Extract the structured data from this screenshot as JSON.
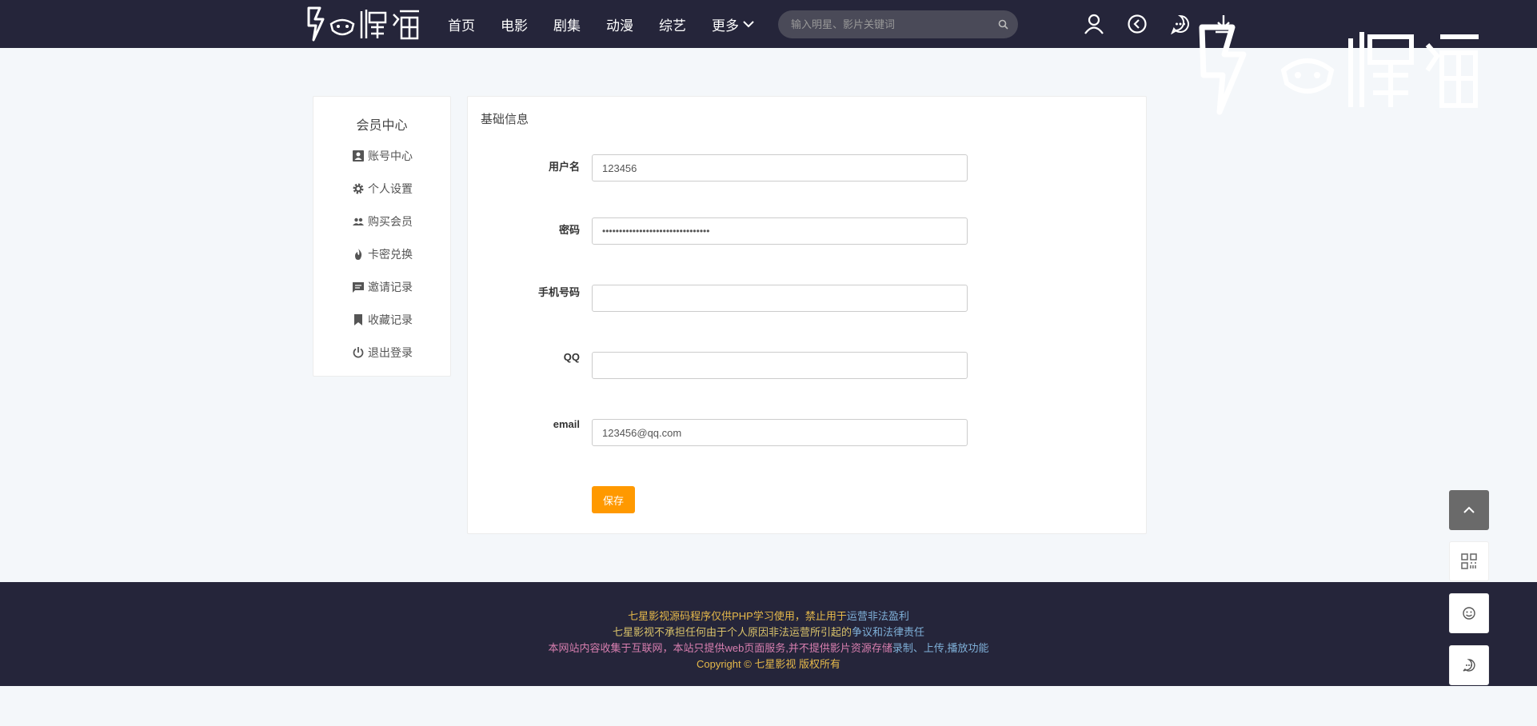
{
  "header": {
    "nav": [
      "首页",
      "电影",
      "剧集",
      "动漫",
      "综艺",
      "更多"
    ],
    "search_placeholder": "输入明星、影片关键词"
  },
  "sidebar": {
    "title": "会员中心",
    "items": [
      "账号中心",
      "个人设置",
      "购买会员",
      "卡密兑换",
      "邀请记录",
      "收藏记录",
      "退出登录"
    ]
  },
  "panel": {
    "title": "基础信息",
    "fields": {
      "username": {
        "label": "用户名",
        "value": "123456"
      },
      "password": {
        "label": "密码",
        "value": "••••••••••••••••••••••••••••••••"
      },
      "phone": {
        "label": "手机号码",
        "value": ""
      },
      "qq": {
        "label": "QQ",
        "value": ""
      },
      "email": {
        "label": "email",
        "value": "123456@qq.com"
      }
    },
    "save_label": "保存"
  },
  "footer": {
    "line1_a": "七星影视源码程序仅供PHP学习使用，禁止用于",
    "line1_b": "运营非法盈利",
    "line2_a": "七星影视不承担任何由于个人原因非法运营所引起的",
    "line2_b": "争议和法律责任",
    "line3_a": "本网站内容收集于互联网，本站只提供web页面服务,并不提供影片资源存储",
    "line3_b": "录制、上传,播放功能",
    "line4": "Copyright ©  七星影视 版权所有"
  },
  "colors": {
    "header_bg": "#25253a",
    "accent": "#ff9900"
  }
}
